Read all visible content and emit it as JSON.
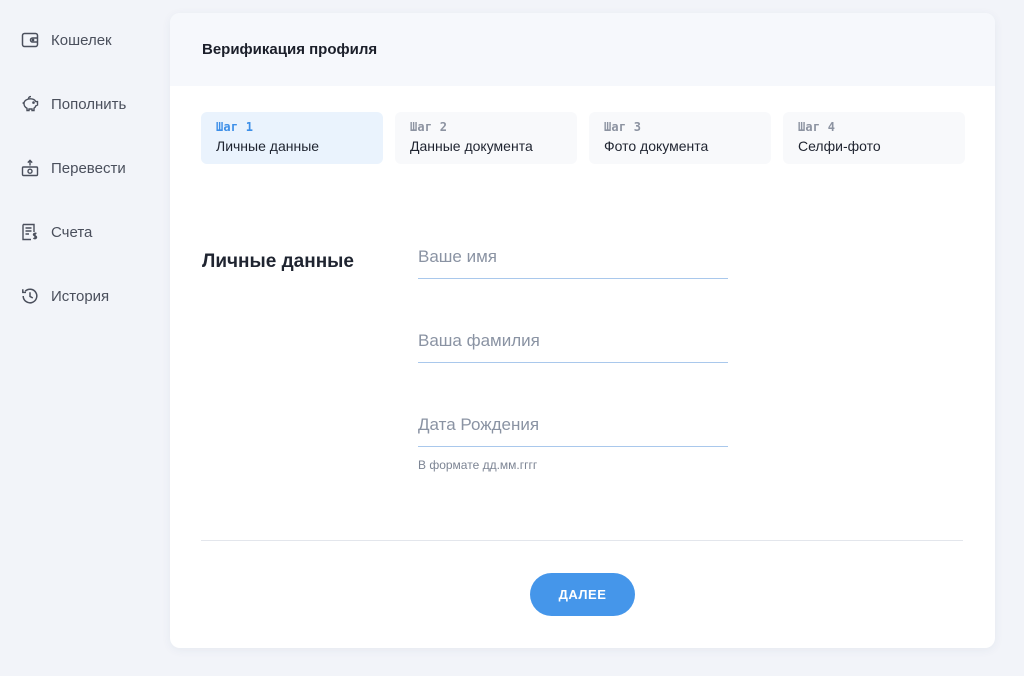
{
  "sidebar": {
    "items": [
      {
        "label": "Кошелек",
        "icon": "wallet-icon"
      },
      {
        "label": "Пополнить",
        "icon": "piggy-bank-icon"
      },
      {
        "label": "Перевести",
        "icon": "money-transfer-icon"
      },
      {
        "label": "Счета",
        "icon": "invoice-icon"
      },
      {
        "label": "История",
        "icon": "history-icon"
      }
    ]
  },
  "card": {
    "title": "Верификация профиля"
  },
  "steps": [
    {
      "number": "Шаг 1",
      "name": "Личные данные",
      "active": true
    },
    {
      "number": "Шаг 2",
      "name": "Данные документа",
      "active": false
    },
    {
      "number": "Шаг 3",
      "name": "Фото документа",
      "active": false
    },
    {
      "number": "Шаг 4",
      "name": "Селфи-фото",
      "active": false
    }
  ],
  "form": {
    "section_title": "Личные данные",
    "first_name": {
      "value": "",
      "placeholder": "Ваше имя"
    },
    "last_name": {
      "value": "",
      "placeholder": "Ваша фамилия"
    },
    "birth_date": {
      "value": "",
      "placeholder": "Дата Рождения",
      "hint": "В формате дд.мм.гггг"
    },
    "next_label": "ДАЛЕЕ"
  },
  "colors": {
    "accent": "#4596ea",
    "active_step_bg": "#eaf3fd",
    "page_bg": "#f2f4f9"
  }
}
